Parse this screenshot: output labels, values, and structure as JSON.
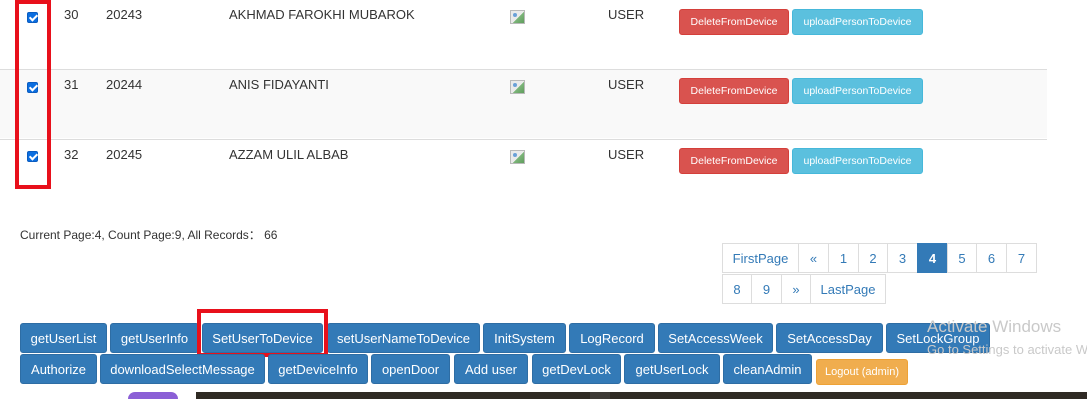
{
  "rows": [
    {
      "no": "30",
      "id": "20243",
      "name": "AKHMAD FAROKHI MUBAROK",
      "role": "USER",
      "delete_label": "DeleteFromDevice",
      "upload_label": "uploadPersonToDevice",
      "checked": true
    },
    {
      "no": "31",
      "id": "20244",
      "name": "ANIS FIDAYANTI",
      "role": "USER",
      "delete_label": "DeleteFromDevice",
      "upload_label": "uploadPersonToDevice",
      "checked": true
    },
    {
      "no": "32",
      "id": "20245",
      "name": "AZZAM ULIL ALBAB",
      "role": "USER",
      "delete_label": "DeleteFromDevice",
      "upload_label": "uploadPersonToDevice",
      "checked": true
    }
  ],
  "status": "Current Page:4, Count Page:9, All Records： 66",
  "pagination": {
    "first": "FirstPage",
    "prev": "«",
    "pages": [
      "1",
      "2",
      "3",
      "4",
      "5",
      "6",
      "7",
      "8",
      "9"
    ],
    "active": "4",
    "next": "»",
    "last": "LastPage"
  },
  "actions_row1": [
    "getUserList",
    "getUserInfo",
    "SetUserToDevice",
    "setUserNameToDevice",
    "InitSystem",
    "LogRecord",
    "SetAccessWeek",
    "SetAccessDay",
    "SetLockGroup"
  ],
  "actions_row2": [
    "Authorize",
    "downloadSelectMessage",
    "getDeviceInfo",
    "openDoor",
    "Add user",
    "getDevLock",
    "getUserLock",
    "cleanAdmin"
  ],
  "logout_label": "Logout (admin)",
  "watermark": {
    "line1": "Activate Windows",
    "line2": "Go to Settings to activate Windows."
  },
  "colors": {
    "primary": "#337ab7",
    "danger": "#d9534f",
    "info": "#5bc0de",
    "warning": "#f0ad4e",
    "highlight": "#e8101b"
  },
  "icons": {
    "photo": "broken-image-icon",
    "checkbox": "checked-checkbox-icon"
  }
}
